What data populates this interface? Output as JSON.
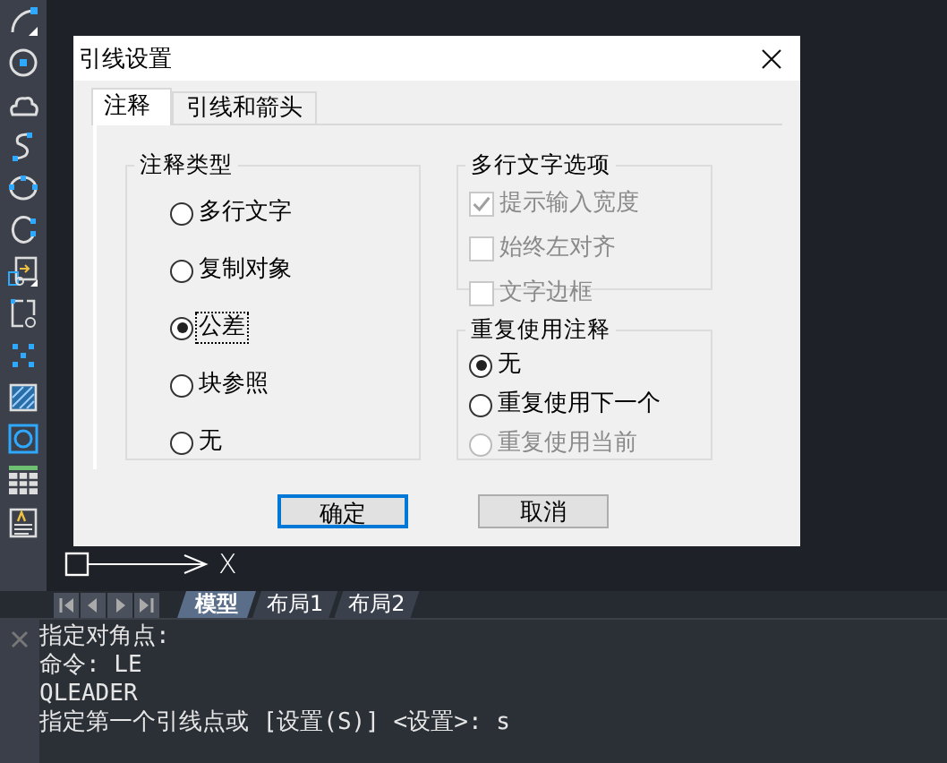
{
  "canvas": {
    "axis_label": "X"
  },
  "dialog": {
    "title": "引线设置",
    "tabs": [
      {
        "label": "注释",
        "selected": true
      },
      {
        "label": "引线和箭头",
        "selected": false
      }
    ],
    "annotation_type": {
      "title": "注释类型",
      "options": [
        {
          "label": "多行文字",
          "selected": false
        },
        {
          "label": "复制对象",
          "selected": false
        },
        {
          "label": "公差",
          "selected": true
        },
        {
          "label": "块参照",
          "selected": false
        },
        {
          "label": "无",
          "selected": false
        }
      ]
    },
    "mtext_options": {
      "title": "多行文字选项",
      "checkboxes": [
        {
          "label": "提示输入宽度",
          "checked": true,
          "disabled": true
        },
        {
          "label": "始终左对齐",
          "checked": false,
          "disabled": true
        },
        {
          "label": "文字边框",
          "checked": false,
          "disabled": true
        }
      ]
    },
    "reuse": {
      "title": "重复使用注释",
      "options": [
        {
          "label": "无",
          "selected": true,
          "disabled": false
        },
        {
          "label": "重复使用下一个",
          "selected": false,
          "disabled": false
        },
        {
          "label": "重复使用当前",
          "selected": false,
          "disabled": true
        }
      ]
    },
    "buttons": [
      {
        "label": "确定",
        "default": true
      },
      {
        "label": "取消",
        "default": false
      }
    ]
  },
  "layout_tabs": [
    {
      "label": "模型",
      "selected": true
    },
    {
      "label": "布局1",
      "selected": false
    },
    {
      "label": "布局2",
      "selected": false
    }
  ],
  "command_lines": [
    "指定对角点:",
    "命令: LE",
    "QLEADER",
    "指定第一个引线点或 [设置(S)] <设置>: s"
  ]
}
